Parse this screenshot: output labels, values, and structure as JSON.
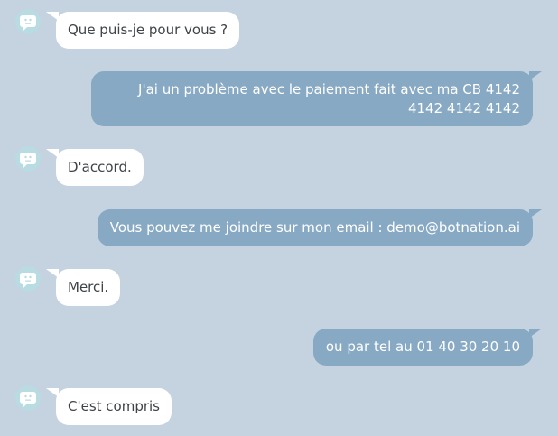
{
  "colors": {
    "background": "#c5d3e0",
    "bot_bubble": "#ffffff",
    "bot_text": "#3e4347",
    "user_bubble": "#87a9c4",
    "user_text": "#ffffff",
    "avatar": "#b9dbe2"
  },
  "avatar_icon": "bot-face-icon",
  "messages": [
    {
      "sender": "bot",
      "text": "Que puis-je pour vous ?"
    },
    {
      "sender": "user",
      "text": "J'ai un problème avec le paiement fait avec ma CB 4142 4142 4142 4142"
    },
    {
      "sender": "bot",
      "text": "D'accord."
    },
    {
      "sender": "user",
      "text": "Vous pouvez me joindre sur mon email : demo@botnation.ai"
    },
    {
      "sender": "bot",
      "text": "Merci."
    },
    {
      "sender": "user",
      "text": "ou par tel au 01 40 30 20 10"
    },
    {
      "sender": "bot",
      "text": "C'est compris"
    }
  ]
}
